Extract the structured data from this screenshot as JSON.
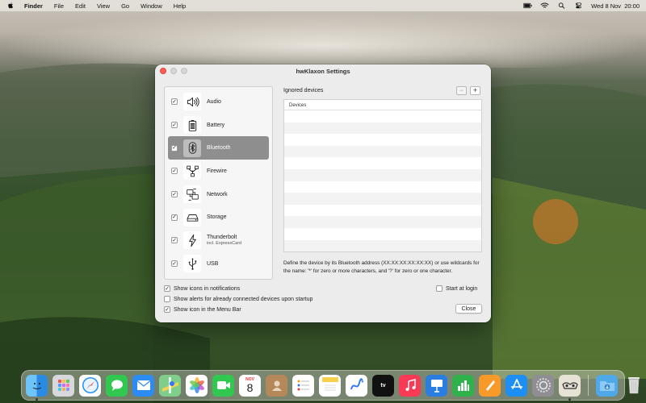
{
  "menubar": {
    "app_name": "Finder",
    "menus": [
      "File",
      "Edit",
      "View",
      "Go",
      "Window",
      "Help"
    ],
    "datetime": "Wed 8 Nov  20:00"
  },
  "window": {
    "title": "hwKlaxon Settings",
    "devices": [
      {
        "label": "Audio",
        "checked": true,
        "icon": "speaker-icon"
      },
      {
        "label": "Battery",
        "checked": true,
        "icon": "battery-icon"
      },
      {
        "label": "Bluetooth",
        "checked": true,
        "icon": "bluetooth-icon",
        "selected": true
      },
      {
        "label": "Firewire",
        "checked": true,
        "icon": "firewire-icon"
      },
      {
        "label": "Network",
        "checked": true,
        "icon": "network-icon"
      },
      {
        "label": "Storage",
        "checked": true,
        "icon": "storage-icon"
      },
      {
        "label": "Thunderbolt",
        "sublabel": "incl. ExpressCard",
        "checked": true,
        "icon": "thunderbolt-icon"
      },
      {
        "label": "USB",
        "checked": true,
        "icon": "usb-icon"
      }
    ],
    "ignored": {
      "title": "Ignored devices",
      "remove_label": "−",
      "add_label": "+",
      "column_header": "Devices",
      "description": "Define the device by its Bluetooth address (XX:XX:XX:XX:XX:XX) or use wildcards for the name: '*' for zero or more characters, and '?' for zero or one character."
    },
    "options": {
      "show_icons": "Show icons in notifications",
      "show_alerts": "Show alerts for already connected devices upon startup",
      "show_menubar_icon": "Show icon in the Menu Bar",
      "start_at_login": "Start at login",
      "show_icons_checked": true,
      "show_alerts_checked": false,
      "show_menubar_icon_checked": true,
      "start_at_login_checked": false
    },
    "close_label": "Close"
  },
  "dock": {
    "calendar_month": "NOV",
    "calendar_day": "8",
    "tv_label": "tv"
  },
  "colors": {
    "selection": "#8e8e8e",
    "close_button": "#fe5f57"
  }
}
